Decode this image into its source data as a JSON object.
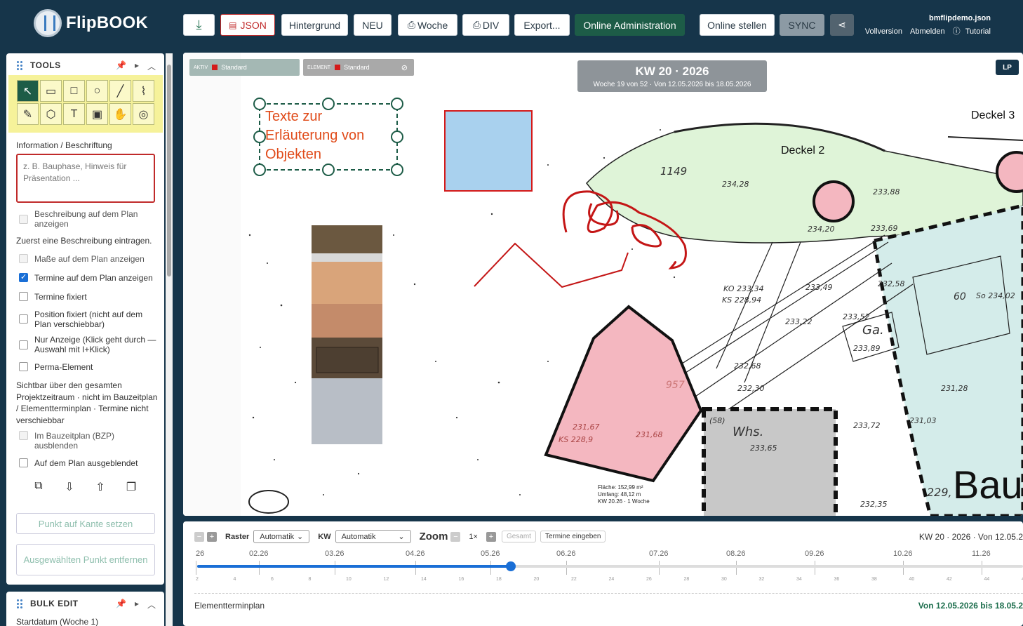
{
  "app": {
    "name": "FlipBOOK"
  },
  "header": {
    "download_label": "⤓",
    "json_label": "JSON",
    "background_label": "Hintergrund",
    "new_label": "NEU",
    "week_label": "Woche",
    "div_label": "DIV",
    "export_label": "Export...",
    "admin_label": "Online Administration",
    "publish_label": "Online stellen",
    "sync_label": "SYNC",
    "share_label": "⋖",
    "file": "bmflipdemo.json",
    "full_version": "Vollversion",
    "logout": "Abmelden",
    "tutorial": "Tutorial"
  },
  "tools_panel": {
    "title": "TOOLS",
    "info_label": "Information / Beschriftung",
    "textarea_placeholder": "z. B. Bauphase, Hinweis für Präsentation ...",
    "options": [
      {
        "label": "Beschreibung auf dem Plan anzeigen",
        "checked": false,
        "disabled": true
      },
      {
        "label": "Maße auf dem Plan anzeigen",
        "checked": false,
        "disabled": true
      },
      {
        "label": "Termine auf dem Plan anzeigen",
        "checked": true,
        "disabled": false
      },
      {
        "label": "Termine fixiert",
        "checked": false,
        "disabled": false
      },
      {
        "label": "Position fixiert (nicht auf dem Plan verschiebbar)",
        "checked": false,
        "disabled": false
      },
      {
        "label": "Nur Anzeige (Klick geht durch — Auswahl mit I+Klick)",
        "checked": false,
        "disabled": false
      },
      {
        "label": "Perma-Element",
        "checked": false,
        "disabled": false
      },
      {
        "label": "Im Bauzeitplan (BZP) ausblenden",
        "checked": false,
        "disabled": true
      },
      {
        "label": "Auf dem Plan ausgeblendet",
        "checked": false,
        "disabled": false
      }
    ],
    "hint_description": "Zuerst eine Beschreibung eintragen.",
    "perma_note": "Sichtbar über den gesamten Projektzeitraum · nicht im Bauzeitplan / Elementterminplan · Termine nicht verschiebbar",
    "set_point_button": "Punkt auf Kante setzen",
    "remove_point_button": "Ausgewählten Punkt entfernen"
  },
  "bulk_panel": {
    "title": "BULK EDIT",
    "start_label": "Startdatum (Woche 1)"
  },
  "canvas": {
    "chip_active_tag": "AKTIV",
    "chip_active_label": "Standard",
    "chip_element_tag": "ELEMENT",
    "chip_element_label": "Standard",
    "kw_title": "KW 20 · 2026",
    "kw_sub": "Woche 19 von 52 · Von 12.05.2026 bis 18.05.2026",
    "lp_label": "LP",
    "text_object": [
      "Texte zur",
      "Erläuterung von",
      "Objekten"
    ],
    "deckel2": "Deckel 2",
    "deckel3": "Deckel 3",
    "bau_label": "Bau",
    "measure": [
      "Fläche: 152,99 m²",
      "Umfang: 48,12 m",
      "KW 20.26 · 1 Woche"
    ],
    "map_numbers": [
      "1149",
      "234,28",
      "233,88",
      "233,69",
      "234,20",
      "KO 233,34",
      "KS 228,94",
      "233,49",
      "233,22",
      "233,52",
      "Ga.",
      "233,89",
      "232,68",
      "232,30",
      "233,72",
      "233,65",
      "Whs.",
      "232,35",
      "232,58",
      "60",
      "So 234,02",
      "231,28",
      "231,03",
      "229,",
      "957",
      "231,67",
      "KS 228,9",
      "231,68",
      "(58)"
    ]
  },
  "timeline": {
    "raster_label": "Raster",
    "raster_value": "Automatik",
    "kw_label": "KW",
    "kw_value": "Automatik",
    "zoom_label": "Zoom",
    "zoom_value": "1×",
    "total_label": "Gesamt",
    "enter_dates_label": "Termine eingeben",
    "status": "KW 20 · 2026 · Von 12.05.2",
    "month_ticks": [
      "26",
      "02.26",
      "03.26",
      "04.26",
      "05.26",
      "06.26",
      "07.26",
      "08.26",
      "09.26",
      "10.26",
      "11.26"
    ],
    "week_ticks": [
      "2",
      "4",
      "6",
      "8",
      "10",
      "12",
      "14",
      "16",
      "18",
      "20",
      "22",
      "24",
      "26",
      "28",
      "30",
      "32",
      "34",
      "36",
      "38",
      "40",
      "42",
      "44",
      "46"
    ],
    "progress": 0.38,
    "element_plan_label": "Elementterminplan",
    "element_plan_range": "Von 12.05.2026 bis 18.05.2"
  }
}
